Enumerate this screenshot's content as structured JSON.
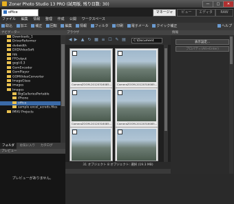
{
  "window": {
    "title": "Zoner Photo Studio 13 PRO (試用版, 残り日数: 30)",
    "min": "—",
    "max": "□",
    "close": "✕"
  },
  "doc_tab": {
    "label": "office"
  },
  "mode_tabs": [
    {
      "label": "マネージャ"
    },
    {
      "label": "ビュー"
    },
    {
      "label": "エディタ"
    },
    {
      "label": "RAW"
    }
  ],
  "menu": [
    "ファイル",
    "編集",
    "情報",
    "整理",
    "作成",
    "公開",
    "ワークスペース"
  ],
  "toolbar": [
    {
      "label": "取込"
    },
    {
      "label": "加工"
    },
    {
      "label": "補正"
    },
    {
      "label": "回転"
    },
    {
      "label": "編集"
    },
    {
      "label": "情報"
    },
    {
      "label": "フィルタ"
    },
    {
      "label": "印刷"
    },
    {
      "label": "電子メール"
    },
    {
      "label": "クイック補正"
    }
  ],
  "toolbar_help": "ヘルプ",
  "left_header": "ナビゲーター",
  "folders": [
    {
      "name": "Downloads_1"
    },
    {
      "name": "DriverReformer"
    },
    {
      "name": "dvdwidth"
    },
    {
      "name": "DXDVideoSoft"
    },
    {
      "name": "fdk"
    },
    {
      "name": "FFOutput"
    },
    {
      "name": "gegl-0.3"
    },
    {
      "name": "GomEncoder"
    },
    {
      "name": "GomPlayer"
    },
    {
      "name": "GOMVideoConverter"
    },
    {
      "name": "ImageGlass"
    },
    {
      "name": "images"
    },
    {
      "name": "Images"
    },
    {
      "name": "BigGalleriesPortable"
    },
    {
      "name": "iPhone"
    },
    {
      "name": "office"
    },
    {
      "name": "sample excel_acreds.files"
    },
    {
      "name": "IMVU Projects"
    }
  ],
  "left_tabs": [
    "フォルダ",
    "お気に入り",
    "カタログ"
  ],
  "preview": {
    "header": "プレビュー",
    "message": "プレビューがありません。"
  },
  "browser": {
    "header": "ブラウザ",
    "path": "C:\\Document"
  },
  "thumbnails": [
    {
      "caption": "CameraZOOM-20120316085..."
    },
    {
      "caption": "CameraZOOM-20120316085..."
    },
    {
      "caption": "CameraZOOM-20120316085..."
    },
    {
      "caption": "CameraZOOM-20120316085..."
    },
    {
      "caption": "CameraZOOM-20120316085..."
    },
    {
      "caption": "CameraZOOM-20120316085..."
    }
  ],
  "status": "31 オブジェクト  8 オブジェクト: 選択 (19.3 MB)",
  "right": {
    "header": "情報",
    "button1": "表示設定...",
    "button2": "プロパティ(Alt+Enter)"
  }
}
